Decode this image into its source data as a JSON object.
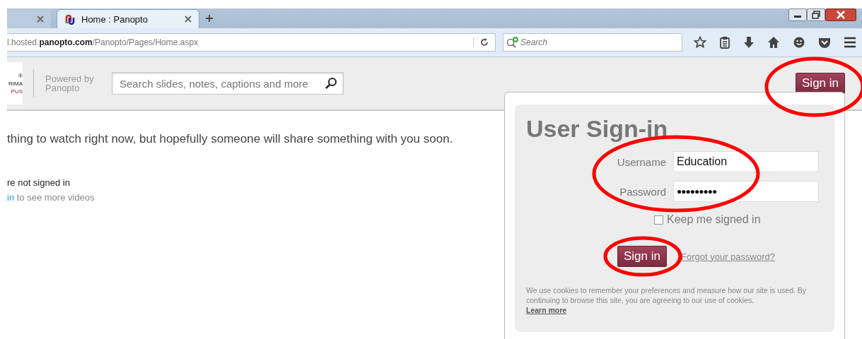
{
  "browser": {
    "tabs": [
      {
        "selected": false
      },
      {
        "label": "Home : Panopto",
        "selected": true
      }
    ],
    "address": {
      "prefix": "l.hosted.",
      "domain": "panopto.com",
      "path": "/Panopto/Pages/Home.aspx"
    },
    "search": {
      "placeholder": "Search"
    }
  },
  "header": {
    "logo_text": [
      "®",
      "RIMA",
      "PUS"
    ],
    "powered_by": "Powered by Panopto",
    "search": {
      "placeholder": "Search slides, notes, captions and more"
    },
    "sign_in": "Sign in"
  },
  "content": {
    "message": "thing to watch right now, but hopefully someone will share something with you soon.",
    "not_signed_in": "re not signed in",
    "link": "in",
    "link_rest": " to see more videos"
  },
  "sign_in_panel": {
    "title": "User Sign-in",
    "fields": [
      {
        "label": "Username",
        "value": "Education"
      },
      {
        "label": "Password",
        "value": "●●●●●●●●●"
      }
    ],
    "keep_signed_in": {
      "label": "Keep me signed in",
      "checked": false
    },
    "button": "Sign in",
    "forgot": "Forgot your password?",
    "cookie_notice": "We use cookies to remember your preferences and measure how our site is used. By continuing to browse this site, you are agreeing to our use of cookies.",
    "learn_more": "Learn more"
  }
}
